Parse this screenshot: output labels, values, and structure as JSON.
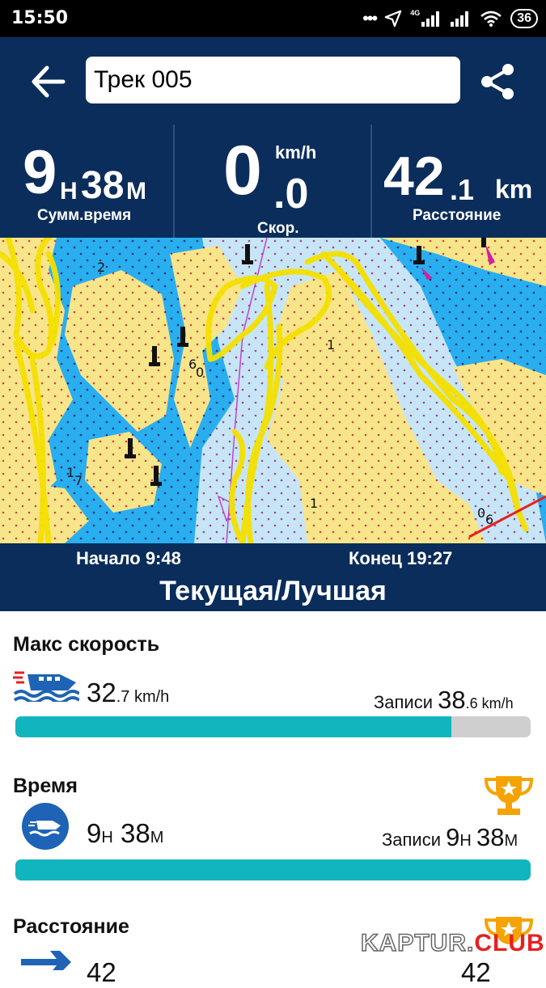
{
  "status_bar": {
    "time": "15:50",
    "network": "4G",
    "battery": "36"
  },
  "header": {
    "title": "Трек 005"
  },
  "stats": {
    "total_time": {
      "hours": "9",
      "h_unit": "Н",
      "minutes": "38",
      "m_unit": "М",
      "label": "Сумм.время"
    },
    "speed": {
      "int": "0",
      "dec": ".0",
      "unit": "km/h",
      "label": "Скор."
    },
    "distance": {
      "int": "42",
      "dec": ".1",
      "unit": "km",
      "label": "Расстояние"
    }
  },
  "map": {
    "marks": [
      "2",
      "6",
      "0",
      "6",
      "1",
      "7",
      "1",
      "0",
      "6",
      "2",
      "1",
      "1",
      "0"
    ]
  },
  "track_info": {
    "start": "Начало 9:48",
    "end": "Конец 19:27",
    "title": "Текущая/Лучшая"
  },
  "sections": {
    "max_speed": {
      "title": "Макс скорость",
      "value_int": "32",
      "value_dec": ".7 km/h",
      "record_label": "Записи",
      "record_int": "38",
      "record_dec": ".6 km/h",
      "progress": 0.846
    },
    "time": {
      "title": "Время",
      "h": "9",
      "h_unit": "Н",
      "m": "38",
      "m_unit": "М",
      "record_label": "Записи",
      "record_h": "9",
      "record_h_unit": "Н",
      "record_m": "38",
      "record_m_unit": "М",
      "progress": 1.0
    },
    "distance": {
      "title": "Расстояние",
      "value": "42",
      "record": "42"
    }
  },
  "watermark": {
    "left": "KAPTUR.",
    "right": "CLUB"
  },
  "colors": {
    "header_bg": "#0b2d5b",
    "accent": "#10b5be",
    "track": "#f5e000",
    "land": "#f7e58a",
    "water": "#29aef0",
    "shallow": "#c6e6f7"
  }
}
